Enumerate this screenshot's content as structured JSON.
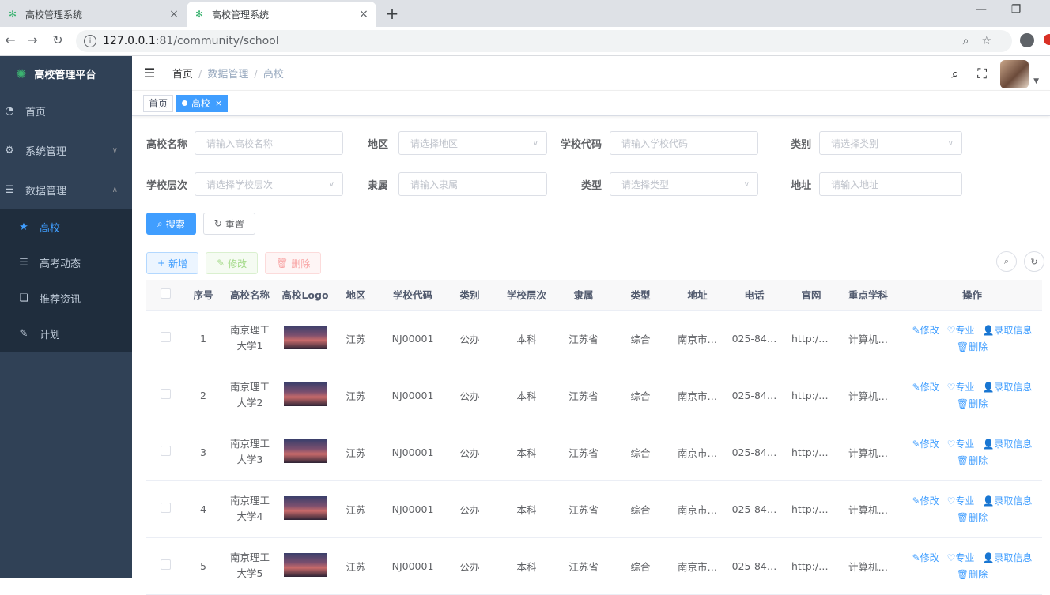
{
  "browser": {
    "tabs": [
      {
        "title": "高校管理系统"
      },
      {
        "title": "高校管理系统"
      }
    ],
    "url_host": "127.0.0.1",
    "url_rest": ":81/community/school"
  },
  "sidebar": {
    "app_title": "高校管理平台",
    "items": [
      {
        "label": "首页"
      },
      {
        "label": "系统管理"
      },
      {
        "label": "数据管理"
      }
    ],
    "subitems": [
      {
        "label": "高校"
      },
      {
        "label": "高考动态"
      },
      {
        "label": "推荐资讯"
      },
      {
        "label": "计划"
      }
    ]
  },
  "breadcrumb": [
    "首页",
    "数据管理",
    "高校"
  ],
  "tags": [
    {
      "label": "首页"
    },
    {
      "label": "高校"
    }
  ],
  "filters": {
    "name": {
      "label": "高校名称",
      "placeholder": "请输入高校名称"
    },
    "region": {
      "label": "地区",
      "placeholder": "请选择地区"
    },
    "code": {
      "label": "学校代码",
      "placeholder": "请输入学校代码"
    },
    "category": {
      "label": "类别",
      "placeholder": "请选择类别"
    },
    "level": {
      "label": "学校层次",
      "placeholder": "请选择学校层次"
    },
    "affiliation": {
      "label": "隶属",
      "placeholder": "请输入隶属"
    },
    "type": {
      "label": "类型",
      "placeholder": "请选择类型"
    },
    "address": {
      "label": "地址",
      "placeholder": "请输入地址"
    }
  },
  "buttons": {
    "search": "搜索",
    "reset": "重置",
    "add": "新增",
    "edit": "修改",
    "delete": "删除"
  },
  "table": {
    "columns": [
      "序号",
      "高校名称",
      "高校Logo",
      "地区",
      "学校代码",
      "类别",
      "学校层次",
      "隶属",
      "类型",
      "地址",
      "电话",
      "官网",
      "重点学科",
      "操作"
    ],
    "row_actions": {
      "edit": "修改",
      "major": "专业",
      "admission": "录取信息",
      "delete": "删除"
    },
    "rows": [
      {
        "no": "1",
        "name": "南京理工大学1",
        "region": "江苏",
        "code": "NJ00001",
        "category": "公办",
        "level": "本科",
        "affiliation": "江苏省",
        "type": "综合",
        "address": "南京市…",
        "phone": "025-84…",
        "site": "http://…",
        "subjects": "计算机…"
      },
      {
        "no": "2",
        "name": "南京理工大学2",
        "region": "江苏",
        "code": "NJ00001",
        "category": "公办",
        "level": "本科",
        "affiliation": "江苏省",
        "type": "综合",
        "address": "南京市…",
        "phone": "025-84…",
        "site": "http://…",
        "subjects": "计算机…"
      },
      {
        "no": "3",
        "name": "南京理工大学3",
        "region": "江苏",
        "code": "NJ00001",
        "category": "公办",
        "level": "本科",
        "affiliation": "江苏省",
        "type": "综合",
        "address": "南京市…",
        "phone": "025-84…",
        "site": "http://…",
        "subjects": "计算机…"
      },
      {
        "no": "4",
        "name": "南京理工大学4",
        "region": "江苏",
        "code": "NJ00001",
        "category": "公办",
        "level": "本科",
        "affiliation": "江苏省",
        "type": "综合",
        "address": "南京市…",
        "phone": "025-84…",
        "site": "http://…",
        "subjects": "计算机…"
      },
      {
        "no": "5",
        "name": "南京理工大学5",
        "region": "江苏",
        "code": "NJ00001",
        "category": "公办",
        "level": "本科",
        "affiliation": "江苏省",
        "type": "综合",
        "address": "南京市…",
        "phone": "025-84…",
        "site": "http://…",
        "subjects": "计算机…"
      }
    ]
  },
  "colors": {
    "accent": "#409eff",
    "sidebar": "#304156",
    "sidebar_sub": "#1f2d3d"
  }
}
